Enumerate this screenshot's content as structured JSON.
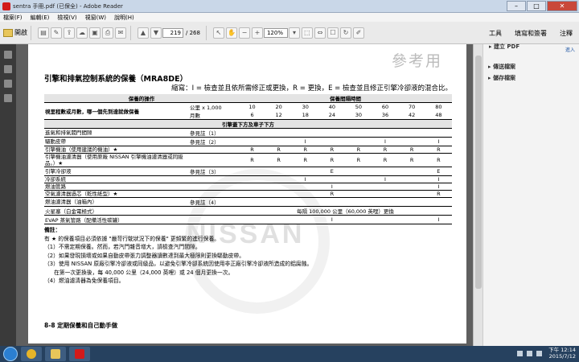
{
  "window": {
    "title": "sentra 手冊.pdf (已保全) - Adobe Reader"
  },
  "menu": [
    "檔案(F)",
    "編輯(E)",
    "檢視(V)",
    "視窗(W)",
    "說明(H)"
  ],
  "toolbar": {
    "open": "開啟",
    "page_current": "219",
    "page_total": "/ 268",
    "zoom": "120%"
  },
  "right_tabs": [
    "工具",
    "填寫和簽署",
    "注釋"
  ],
  "right_panel": {
    "advanced": "進入",
    "items": [
      "建立 PDF",
      "傳送檔案",
      "儲存檔案"
    ]
  },
  "doc": {
    "stamp": "參考用",
    "title": "引擎和排氣控制系統的保養（MRA8DE）",
    "abbrev": "縮寫：I = 檢查並且依所需修正或更換，R = 更換，E = 檢查並且修正引擎冷卻液的混合比。",
    "hdr_op": "保養的操作",
    "hdr_interval": "保養間隔時間",
    "interval_label": "視里程數或月數，哪一個先到達就做保養",
    "unit_km": "公里 x 1,000",
    "unit_month": "月數",
    "km": [
      "10",
      "20",
      "30",
      "40",
      "50",
      "60",
      "70",
      "80"
    ],
    "months": [
      "6",
      "12",
      "18",
      "24",
      "30",
      "36",
      "42",
      "48"
    ],
    "engine_hdr": "引擎蓋下方及車子下方",
    "rows": [
      {
        "label": "進氣和排氣閥門間隙",
        "note": "參見註（1）",
        "vals": [
          "",
          "",
          "",
          "",
          "",
          "",
          "",
          ""
        ]
      },
      {
        "label": "驅動皮帶",
        "note": "參見註（2）",
        "vals": [
          "",
          "",
          "I",
          "",
          "",
          "I",
          "",
          "I"
        ]
      },
      {
        "label": "引擎機油（使用建議的機油）★",
        "note": "",
        "vals": [
          "R",
          "R",
          "R",
          "R",
          "R",
          "R",
          "R",
          "R"
        ]
      },
      {
        "label": "引擎機油濾清器（使用原廠 NISSAN 引擎機油濾清器或同級品。）★",
        "note": "",
        "vals": [
          "R",
          "R",
          "R",
          "R",
          "R",
          "R",
          "R",
          "R"
        ],
        "tall": true
      },
      {
        "label": "引擎冷卻液",
        "note": "參見註（3）",
        "vals": [
          "",
          "",
          "",
          "E",
          "",
          "",
          "",
          "E"
        ]
      },
      {
        "label": "冷卻系統",
        "note": "",
        "vals": [
          "",
          "",
          "I",
          "",
          "",
          "I",
          "",
          "I"
        ]
      },
      {
        "label": "燃油管路",
        "note": "",
        "vals": [
          "",
          "",
          "",
          "I",
          "",
          "",
          "",
          "I"
        ]
      },
      {
        "label": "空氣濾清器過芯（乾性紙型）★",
        "note": "",
        "vals": [
          "",
          "",
          "",
          "R",
          "",
          "",
          "",
          "R"
        ]
      },
      {
        "label": "燃油濾清器（油箱內）",
        "note": "參見註（4）",
        "vals": [
          "",
          "",
          "",
          "",
          "",
          "",
          "",
          ""
        ]
      }
    ],
    "spark": {
      "label": "火星塞（白金電極式）",
      "text": "每隔 100,000 公里（60,000 英哩）更換"
    },
    "evap": {
      "label": "EVAP 蒸氣管路（配備活性碳罐）",
      "vals": [
        "",
        "",
        "",
        "I",
        "",
        "",
        "",
        "I"
      ]
    },
    "notes_title": "備註：",
    "notes": [
      "有 ★ 的保養項目必須依據 \"嚴苛行駛狀況下的保養\" 更頻繁的進行保養。",
      "（1）不需定期保養。然而，若汽門雜音增大，請檢查汽門間隙。",
      "（2）如果發現損壞或如果自動皮帶張力調整器讀數達到最大極限則更換驅動皮帶。",
      "（3）使用 NISSAN 原廠引擎冷卻液或同級品，以避免引擎冷卻系統因使用非正廠引擎冷卻液所造成的鋁腐蝕。",
      "在第一次更換後，每 40,000 公里（24,000 英哩）或 24 個月更換一次。",
      "（4）燃油濾清器為免保養項目。"
    ],
    "footer": "8-8   定期保養和自己動手做",
    "watermark": "NISSAN"
  },
  "taskbar": {
    "time": "下午 12:14",
    "date": "2015/7/12"
  }
}
